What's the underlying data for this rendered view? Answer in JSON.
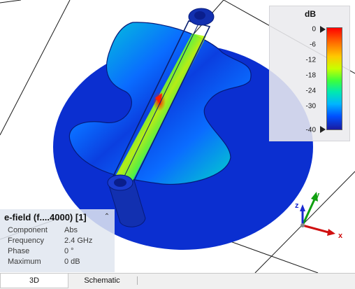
{
  "legend": {
    "unit": "dB",
    "ticks": [
      "0",
      "-6",
      "-12",
      "-18",
      "-24",
      "-30",
      "-40"
    ],
    "range": [
      -40,
      0
    ]
  },
  "info": {
    "title": "e-field (f....4000) [1]",
    "rows": [
      {
        "label": "Component",
        "value": "Abs"
      },
      {
        "label": "Frequency",
        "value": "2.4 GHz"
      },
      {
        "label": "Phase",
        "value": "0 °"
      },
      {
        "label": "Maximum",
        "value": "0 dB"
      }
    ]
  },
  "axes": {
    "x": "x",
    "y": "y",
    "z": "z"
  },
  "tabs": [
    {
      "label": "3D",
      "active": true
    },
    {
      "label": "Schematic",
      "active": false
    }
  ]
}
